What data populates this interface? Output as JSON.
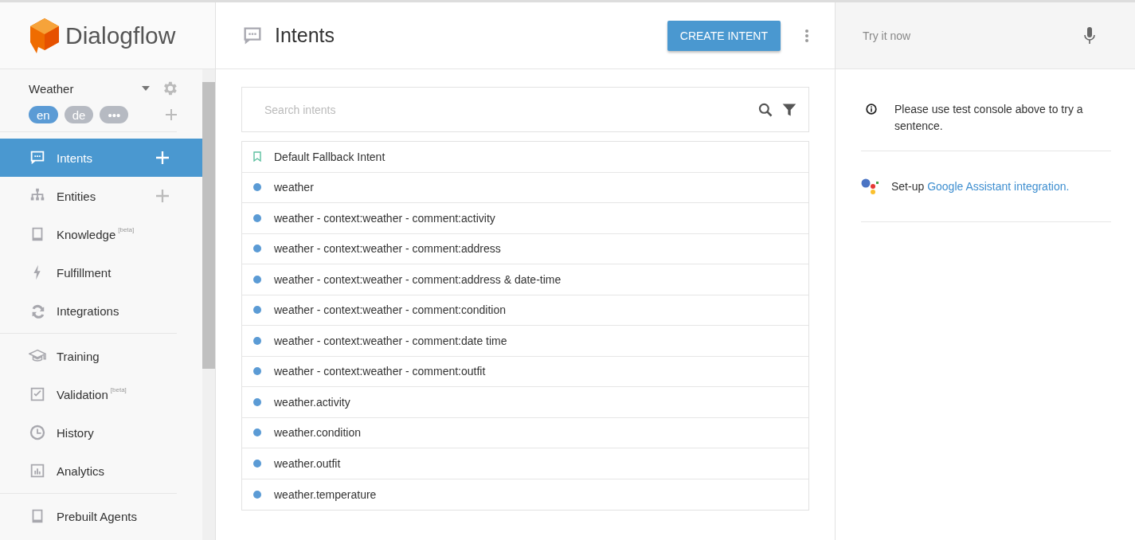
{
  "logo": {
    "text": "Dialogflow"
  },
  "agent": {
    "name": "Weather"
  },
  "languages": [
    {
      "label": "en",
      "selected": true
    },
    {
      "label": "de",
      "selected": false
    },
    {
      "label": "•••",
      "selected": false
    }
  ],
  "sidebar": {
    "groups": [
      [
        {
          "label": "Intents",
          "add": true,
          "selected": true
        },
        {
          "label": "Entities",
          "add": true,
          "selected": false
        },
        {
          "label": "Knowledge",
          "badge": "[beta]",
          "add": false,
          "selected": false
        },
        {
          "label": "Fulfillment",
          "add": false,
          "selected": false
        },
        {
          "label": "Integrations",
          "add": false,
          "selected": false
        }
      ],
      [
        {
          "label": "Training",
          "add": false,
          "selected": false
        },
        {
          "label": "Validation",
          "badge": "[beta]",
          "add": false,
          "selected": false
        },
        {
          "label": "History",
          "add": false,
          "selected": false
        },
        {
          "label": "Analytics",
          "add": false,
          "selected": false
        }
      ],
      [
        {
          "label": "Prebuilt Agents",
          "add": false,
          "selected": false
        }
      ]
    ]
  },
  "page": {
    "title": "Intents",
    "action": "CREATE INTENT"
  },
  "search": {
    "placeholder": "Search intents"
  },
  "intents": [
    {
      "kind": "fallback",
      "name": "Default Fallback Intent"
    },
    {
      "kind": "intent",
      "name": "weather"
    },
    {
      "kind": "intent",
      "name": "weather - context:weather - comment:activity"
    },
    {
      "kind": "intent",
      "name": "weather - context:weather - comment:address"
    },
    {
      "kind": "intent",
      "name": "weather - context:weather - comment:address & date-time"
    },
    {
      "kind": "intent",
      "name": "weather - context:weather - comment:condition"
    },
    {
      "kind": "intent",
      "name": "weather - context:weather - comment:date time"
    },
    {
      "kind": "intent",
      "name": "weather - context:weather - comment:outfit"
    },
    {
      "kind": "intent",
      "name": "weather.activity"
    },
    {
      "kind": "intent",
      "name": "weather.condition"
    },
    {
      "kind": "intent",
      "name": "weather.outfit"
    },
    {
      "kind": "intent",
      "name": "weather.temperature"
    }
  ],
  "test_console": {
    "placeholder": "Try it now",
    "notice": "Please use test console above to try a sentence.",
    "setup_prefix": "Set-up",
    "setup_link": "Google Assistant integration."
  }
}
